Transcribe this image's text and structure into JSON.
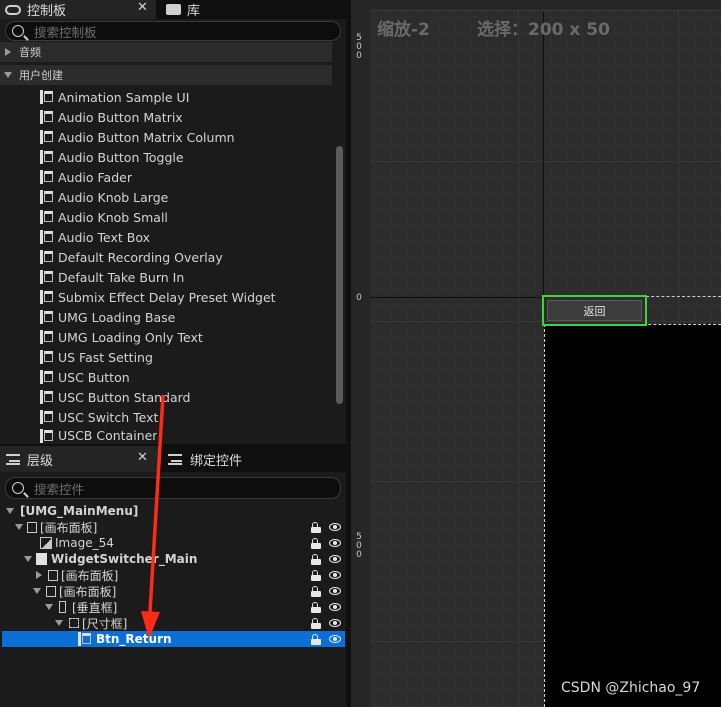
{
  "palette": {
    "tab_label": "控制板",
    "library_tab_label": "库",
    "search_placeholder": "搜索控制板",
    "categories": [
      {
        "label": "音频"
      },
      {
        "label": "用户创建"
      }
    ],
    "items": [
      "Animation Sample UI",
      "Audio Button Matrix",
      "Audio Button Matrix Column",
      "Audio Button Toggle",
      "Audio Fader",
      "Audio Knob Large",
      "Audio Knob Small",
      "Audio Text Box",
      "Default Recording Overlay",
      "Default Take Burn In",
      "Submix Effect Delay Preset Widget",
      "UMG Loading Base",
      "UMG Loading Only Text",
      "US Fast Setting",
      "USC Button",
      "USC Button Standard",
      "USC Switch Text",
      "USCB Container"
    ]
  },
  "hierarchy": {
    "tab_label": "层级",
    "bind_tab_label": "绑定控件",
    "search_placeholder": "搜索控件",
    "rows": [
      {
        "label": "[UMG_MainMenu]"
      },
      {
        "label": "[画布面板]"
      },
      {
        "label": "Image_54"
      },
      {
        "label": "WidgetSwitcher_Main"
      },
      {
        "label": "[画布面板]"
      },
      {
        "label": "[画布面板]"
      },
      {
        "label": "[垂直框]"
      },
      {
        "label": "[尺寸框]"
      },
      {
        "label": "Btn_Return"
      }
    ]
  },
  "designer": {
    "zoom_label": "缩放-2",
    "selection_label": "选择：200 x 50",
    "button_text": "返回",
    "ruler_top_label": [
      "5",
      "0",
      "0"
    ],
    "ruler_mid_label": "0",
    "ruler_bottom_label": [
      "5",
      "0",
      "0"
    ]
  },
  "watermark": "CSDN @Zhichao_97",
  "colors": {
    "selection": "#0b6fd6",
    "widget_outline": "#3ed43e",
    "annotation_arrow": "#ff2a1a"
  }
}
